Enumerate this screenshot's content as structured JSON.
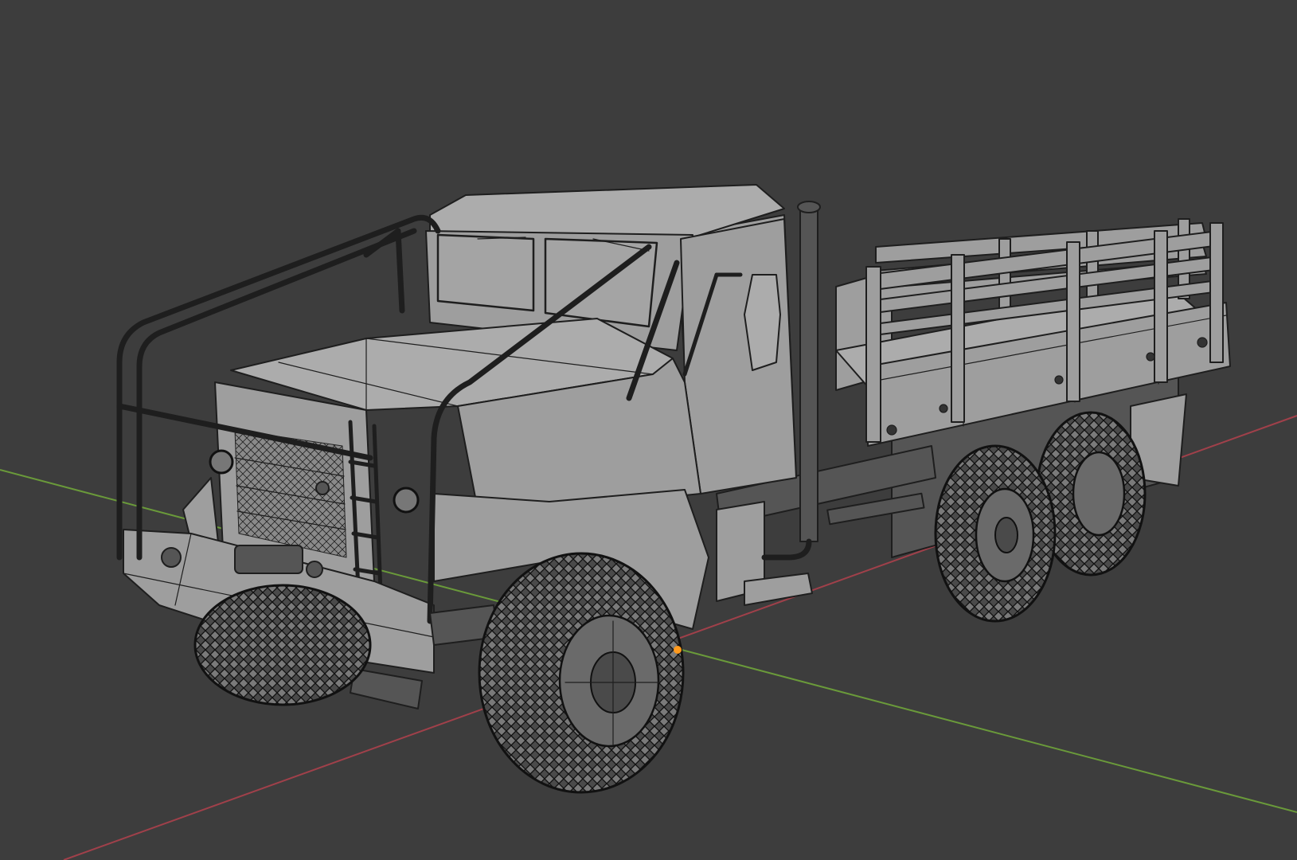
{
  "viewport": {
    "mode": "3d-viewport",
    "background_color": "#3d3d3d",
    "shading": "solid-wireframe-overlay"
  },
  "axes": {
    "x_axis_color": "#a0404a",
    "y_axis_color": "#6a9a3a"
  },
  "model": {
    "object_type": "6x6-military-cargo-truck",
    "mesh_color": "#9e9e9e",
    "wire_color": "#1e1e1e",
    "origin_color": "#ff9a1e",
    "selected": false
  }
}
